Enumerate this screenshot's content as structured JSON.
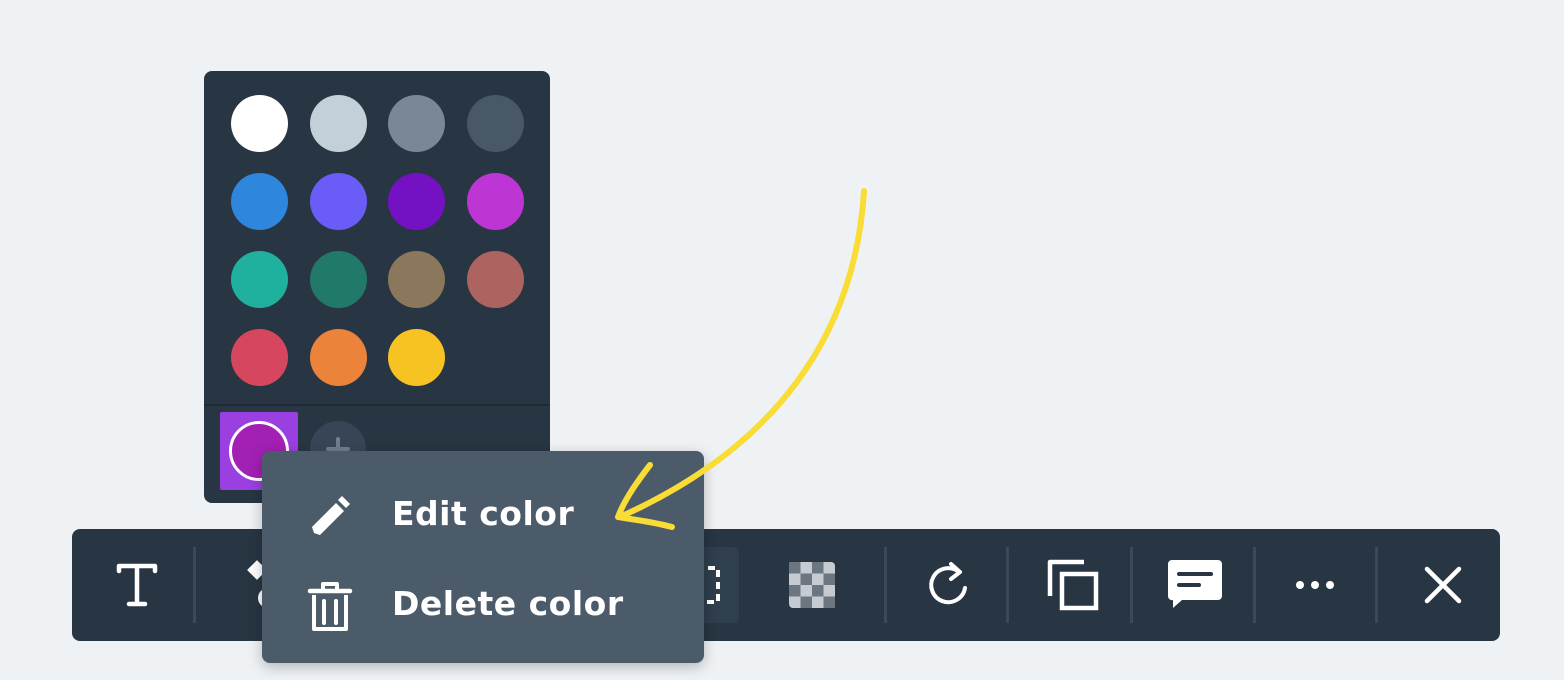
{
  "palette": {
    "swatches": [
      "#ffffff",
      "#c4d0d9",
      "#7a8896",
      "#485866",
      "#2f86dd",
      "#6a5cf6",
      "#7412c3",
      "#bd35d5",
      "#1fb19e",
      "#217a69",
      "#8b775b",
      "#ad6460",
      "#d6475f",
      "#eb843a",
      "#f7c323"
    ],
    "custom_color": "#a220b4",
    "add_icon": "plus-icon"
  },
  "toolbar": {
    "tools": [
      {
        "icon": "text-icon"
      },
      {
        "icon": "shapes-icon"
      },
      {
        "icon": "border-style-icon"
      },
      {
        "icon": "opacity-icon"
      },
      {
        "icon": "rotate-icon"
      },
      {
        "icon": "duplicate-icon"
      },
      {
        "icon": "comment-icon"
      },
      {
        "icon": "more-icon"
      },
      {
        "icon": "close-icon"
      }
    ]
  },
  "context_menu": {
    "edit_label": "Edit color",
    "edit_icon": "pencil-icon",
    "delete_label": "Delete color",
    "delete_icon": "trash-icon"
  },
  "annotation": {
    "arrow_color": "#f9dc36"
  }
}
